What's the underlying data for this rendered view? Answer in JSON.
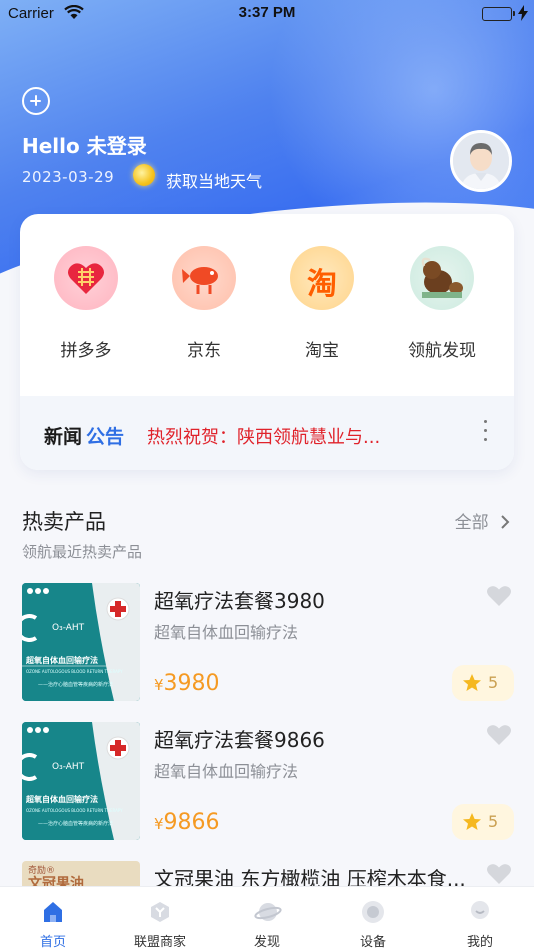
{
  "status_bar": {
    "carrier": "Carrier",
    "time": "3:37 PM"
  },
  "header": {
    "greeting": "Hello 未登录",
    "date": "2023-03-29",
    "weather_label": "获取当地天气"
  },
  "shortcuts": [
    {
      "label": "拼多多",
      "icon": "pinduoduo-icon"
    },
    {
      "label": "京东",
      "icon": "jd-icon"
    },
    {
      "label": "淘宝",
      "icon": "taobao-icon",
      "glyph": "淘"
    },
    {
      "label": "领航发现",
      "icon": "discover-icon"
    }
  ],
  "news": {
    "title_part1": "新闻",
    "title_part2": "公告",
    "text": "热烈祝贺：陕西领航慧业与..."
  },
  "hot_products": {
    "title": "热卖产品",
    "subtitle": "领航最近热卖产品",
    "see_all": "全部",
    "items": [
      {
        "name": "超氧疗法套餐3980",
        "desc": "超氧自体血回输疗法",
        "currency": "¥",
        "price": "3980",
        "rating": "5",
        "thumb": {
          "title": "超氧自体血回输疗法",
          "en": "OZONE AUTOLOGOUS BLOOD RETURN THERAPY",
          "sub": "——治疗心脑血管等疾病的新疗法",
          "logo": "O₃-AHT"
        }
      },
      {
        "name": "超氧疗法套餐9866",
        "desc": "超氧自体血回输疗法",
        "currency": "¥",
        "price": "9866",
        "rating": "5",
        "thumb": {
          "title": "超氧自体血回输疗法",
          "en": "OZONE AUTOLOGOUS BLOOD RETURN THERAPY",
          "sub": "——治疗心脑血管等疾病的新疗法",
          "logo": "O₃-AHT"
        }
      },
      {
        "name": "文冠果油 东方橄榄油 压榨木本食...",
        "thumb": {
          "brand": "奇励®",
          "title": "文冠果油"
        }
      }
    ]
  },
  "tabbar": [
    {
      "label": "首页",
      "active": true
    },
    {
      "label": "联盟商家",
      "active": false
    },
    {
      "label": "发现",
      "active": false
    },
    {
      "label": "设备",
      "active": false
    },
    {
      "label": "我的",
      "active": false
    }
  ],
  "colors": {
    "primary": "#2f6fe4",
    "price": "#f59a23",
    "news_text": "#e0232b",
    "teal_thumb": "#17868a"
  }
}
